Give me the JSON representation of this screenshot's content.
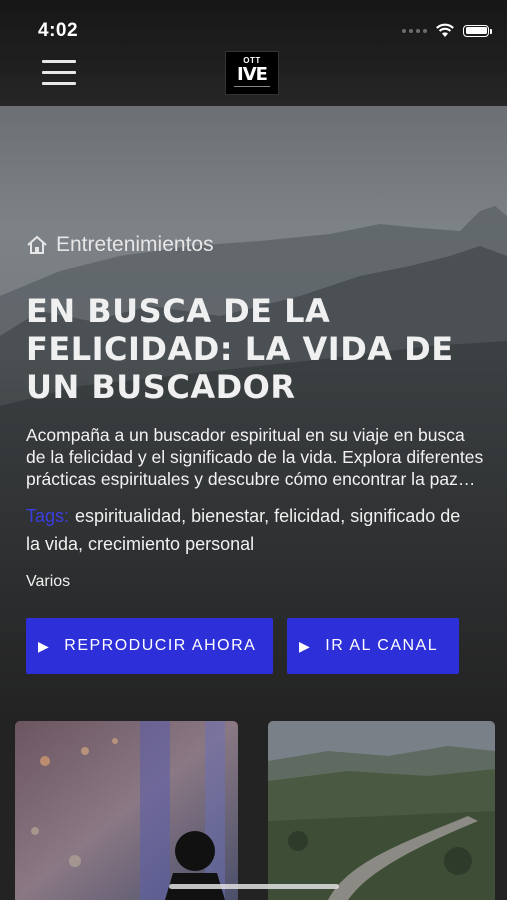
{
  "status_bar": {
    "time": "4:02"
  },
  "header": {
    "logo_top": "OTT",
    "logo_main": "IVE"
  },
  "hero": {
    "breadcrumb": "Entretenimientos",
    "title": "EN BUSCA DE LA FELICIDAD: LA VIDA DE UN BUSCADOR",
    "description": "Acompaña a un buscador espiritual en su viaje en busca de la felicidad y el significado de la vida. Explora diferentes prácticas espirituales y descubre cómo encontrar la paz interior.",
    "tags_label": "Tags:",
    "tags": "espiritualidad, bienestar, felicidad, significado de la vida, crecimiento personal",
    "category": "Varios",
    "play_button": "REPRODUCIR AHORA",
    "channel_button": "IR AL CANAL"
  },
  "icons": {
    "menu": "hamburger-icon",
    "home": "home-icon",
    "play": "play-icon",
    "wifi": "wifi-icon",
    "battery": "battery-icon"
  },
  "colors": {
    "accent": "#2d2fd8",
    "tags_label": "#3b3fe0",
    "background": "#232323"
  }
}
